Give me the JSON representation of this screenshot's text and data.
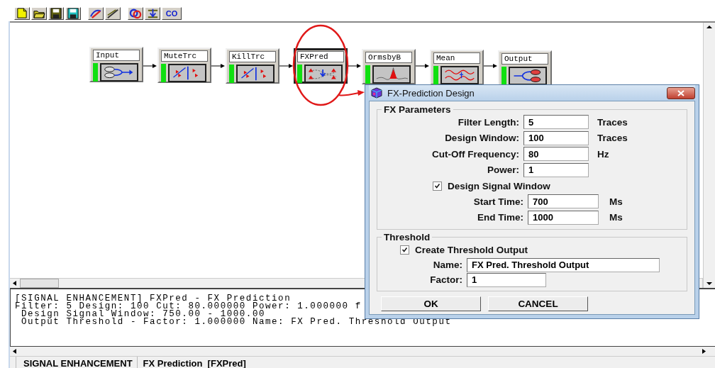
{
  "toolbar": [
    {
      "kind": "new"
    },
    {
      "kind": "open"
    },
    {
      "kind": "save"
    },
    {
      "kind": "save-as"
    },
    {
      "kind": "edit"
    },
    {
      "kind": "draw"
    },
    {
      "kind": "link"
    },
    {
      "kind": "insert"
    },
    {
      "kind": "text",
      "label": "CO"
    }
  ],
  "flow": {
    "nodes": [
      {
        "label": "Input",
        "kind": "input",
        "selected": false
      },
      {
        "label": "MuteTrc",
        "kind": "mute",
        "selected": false
      },
      {
        "label": "KillTrc",
        "kind": "mute",
        "selected": false
      },
      {
        "label": "FXPred",
        "kind": "fxpred",
        "selected": true
      },
      {
        "label": "OrmsbyB",
        "kind": "bandpass",
        "selected": false
      },
      {
        "label": "Mean",
        "kind": "mean",
        "selected": false
      },
      {
        "label": "Output",
        "kind": "output",
        "selected": false
      }
    ]
  },
  "log": {
    "lines": [
      "[SIGNAL ENHANCEMENT] FXPred - FX Prediction",
      "Filter: 5 Design: 100 Cut: 80.000000 Power: 1.000000 f",
      " Design Signal Window: 750.00 - 1000.00",
      " Output Threshold - Factor: 1.000000 Name: FX Pred. Threshold Output"
    ]
  },
  "dialog": {
    "title": "FX-Prediction Design",
    "groups": [
      {
        "title": "FX Parameters",
        "rows": [
          {
            "kind": "field",
            "label": "Filter Length:",
            "value": "5",
            "unit": "Traces"
          },
          {
            "kind": "field",
            "label": "Design Window:",
            "value": "100",
            "unit": "Traces"
          },
          {
            "kind": "field",
            "label": "Cut-Off Frequency:",
            "value": "80",
            "unit": "Hz"
          },
          {
            "kind": "field",
            "label": "Power:",
            "value": "1"
          },
          {
            "kind": "check",
            "label": "Design Signal Window",
            "checked": true
          },
          {
            "kind": "field",
            "label": "Start Time:",
            "value": "700",
            "unit": "Ms"
          },
          {
            "kind": "field",
            "label": "End Time:",
            "value": "1000",
            "unit": "Ms"
          }
        ]
      },
      {
        "title": "Threshold",
        "rows": [
          {
            "kind": "check",
            "label": "Create Threshold Output",
            "checked": true
          },
          {
            "kind": "field",
            "label": "Name:",
            "value": "FX Pred. Threshold Output"
          },
          {
            "kind": "field",
            "label": "Factor:",
            "value": "1"
          }
        ]
      }
    ],
    "buttons": [
      "OK",
      "CANCEL"
    ]
  },
  "status_bar": [
    "SIGNAL ENHANCEMENT",
    "FX Prediction  [FXPred]"
  ]
}
